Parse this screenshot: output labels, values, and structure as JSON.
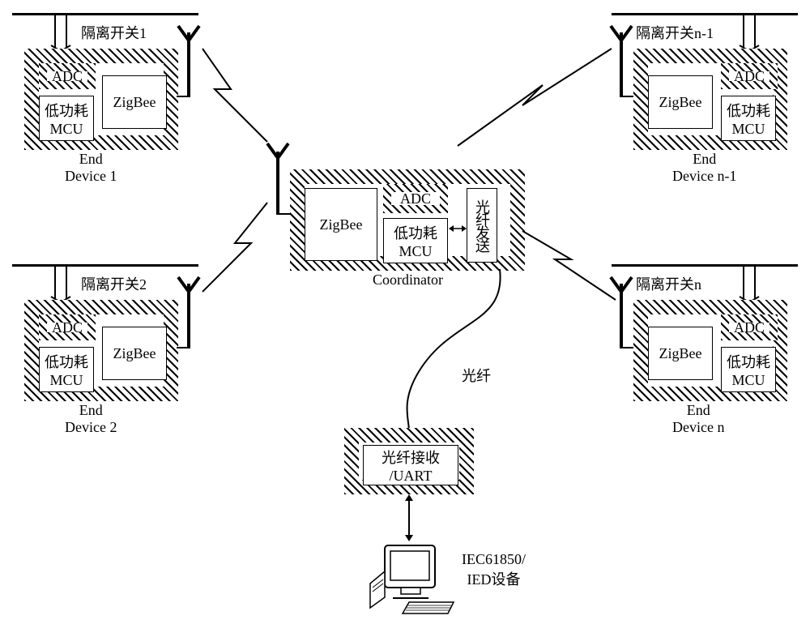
{
  "devices": {
    "d1": {
      "switch_label": "隔离开关1",
      "name": "End\nDevice 1",
      "adc": "ADC",
      "mcu": "低功耗\nMCU",
      "zigbee": "ZigBee"
    },
    "d2": {
      "switch_label": "隔离开关2",
      "name": "End\nDevice 2",
      "adc": "ADC",
      "mcu": "低功耗\nMCU",
      "zigbee": "ZigBee"
    },
    "dn1": {
      "switch_label": "隔离开关n-1",
      "name": "End\nDevice n-1",
      "adc": "ADC",
      "mcu": "低功耗\nMCU",
      "zigbee": "ZigBee"
    },
    "dn": {
      "switch_label": "隔离开关n",
      "name": "End\nDevice n",
      "adc": "ADC",
      "mcu": "低功耗\nMCU",
      "zigbee": "ZigBee"
    }
  },
  "coordinator": {
    "name": "Coordinator",
    "adc": "ADC",
    "mcu": "低功耗\nMCU",
    "zigbee": "ZigBee",
    "fiber_tx": "光纤发送"
  },
  "fiber_label": "光纤",
  "receiver": {
    "label": "光纤接收\n/UART"
  },
  "ied": {
    "label": "IEC61850/\nIED设备"
  }
}
